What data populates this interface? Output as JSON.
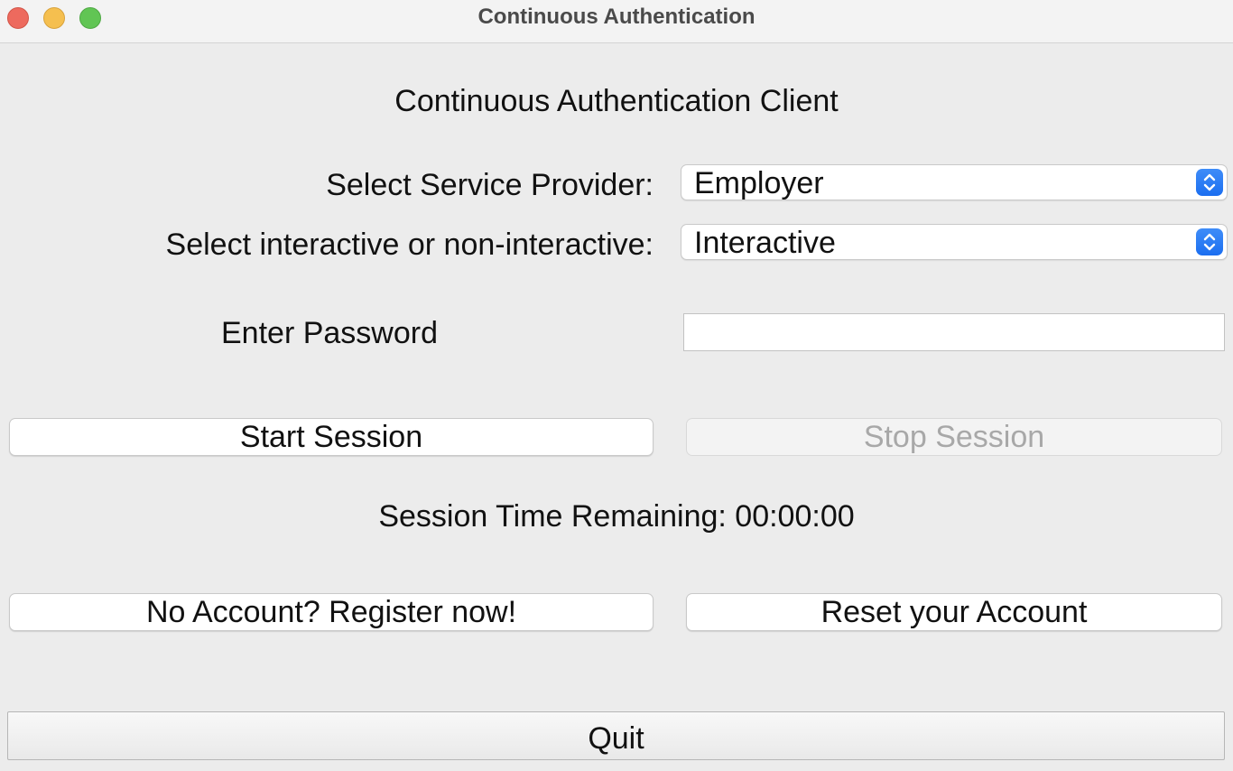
{
  "window": {
    "title": "Continuous Authentication"
  },
  "app": {
    "heading": "Continuous Authentication Client"
  },
  "provider": {
    "label": "Select Service Provider:",
    "value": "Employer"
  },
  "mode": {
    "label": "Select interactive or non-interactive:",
    "value": "Interactive"
  },
  "password": {
    "label": "Enter Password",
    "value": ""
  },
  "session": {
    "start_label": "Start Session",
    "stop_label": "Stop Session",
    "time_remaining": "Session Time Remaining: 00:00:00"
  },
  "account": {
    "register_label": "No Account? Register now!",
    "reset_label": "Reset your Account"
  },
  "quit_label": "Quit",
  "colors": {
    "accent": "#1b6ef0",
    "close": "#ed6a5e",
    "minimize": "#f5bf4f",
    "zoom": "#61c554",
    "disabled_text": "#a8a8a8"
  },
  "icons": {
    "select_indicator": "up-down-chevron-icon"
  }
}
